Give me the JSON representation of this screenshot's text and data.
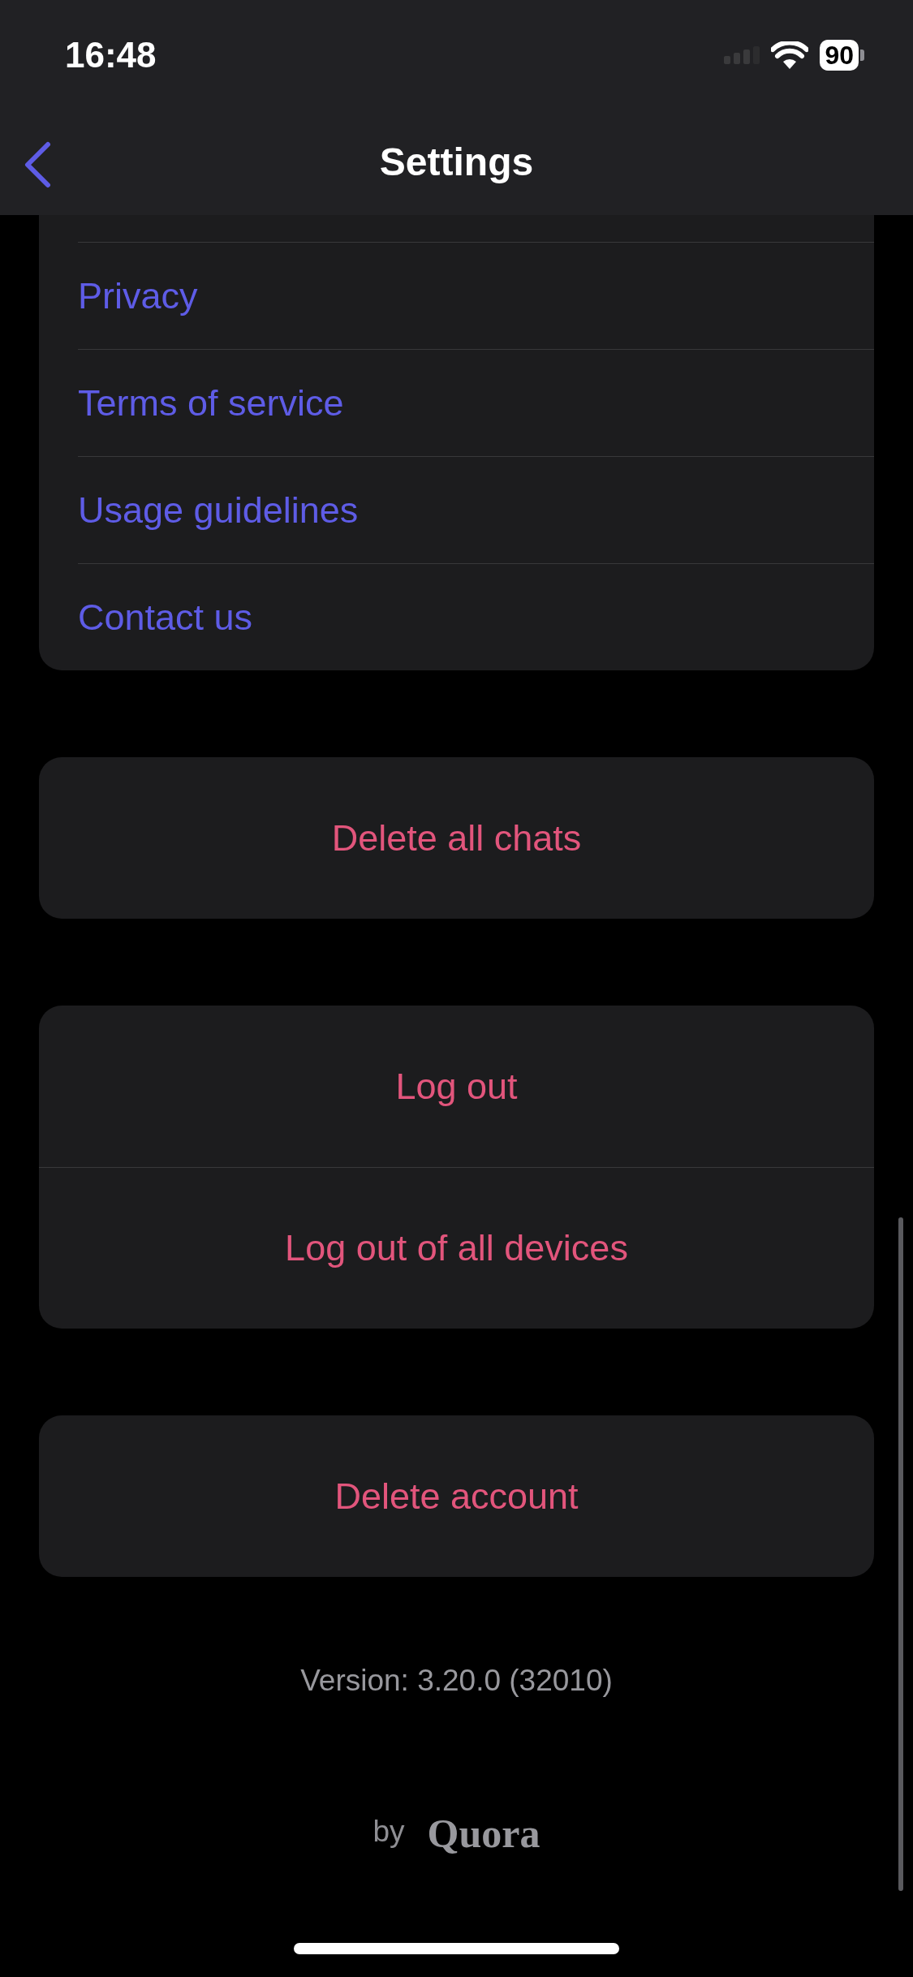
{
  "status_bar": {
    "time": "16:48",
    "battery": "90"
  },
  "nav": {
    "title": "Settings"
  },
  "links": [
    {
      "label": "Privacy"
    },
    {
      "label": "Terms of service"
    },
    {
      "label": "Usage guidelines"
    },
    {
      "label": "Contact us"
    }
  ],
  "action_groups": [
    [
      "Delete all chats"
    ],
    [
      "Log out",
      "Log out of all devices"
    ],
    [
      "Delete account"
    ]
  ],
  "version": "Version: 3.20.0 (32010)",
  "footer": {
    "by": "by",
    "brand": "Quora"
  }
}
